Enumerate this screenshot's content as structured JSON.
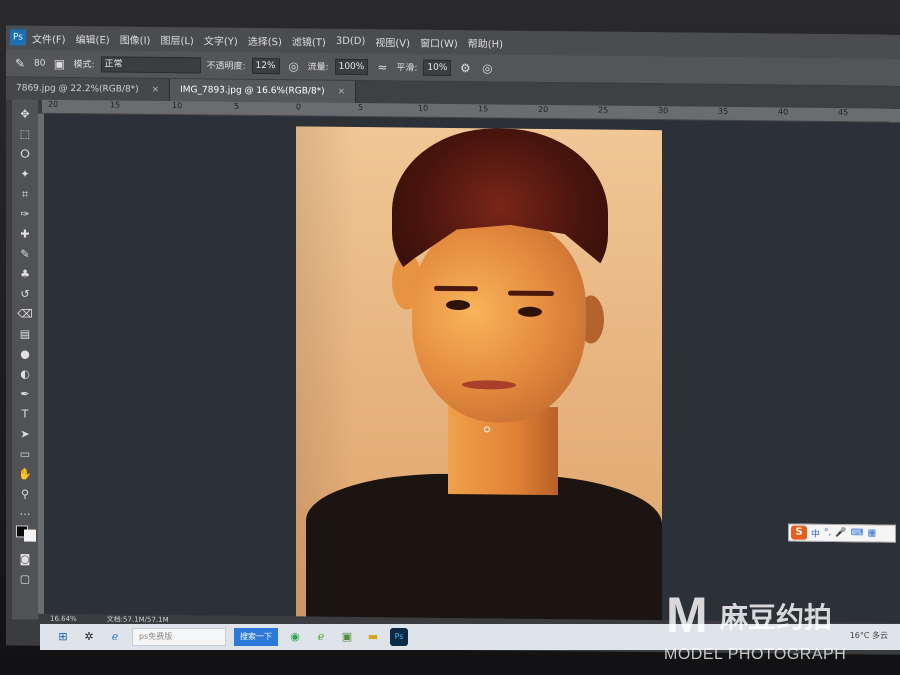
{
  "menubar": {
    "app_icon": "Ps",
    "items": [
      "文件(F)",
      "编辑(E)",
      "图像(I)",
      "图层(L)",
      "文字(Y)",
      "选择(S)",
      "滤镜(T)",
      "3D(D)",
      "视图(V)",
      "窗口(W)",
      "帮助(H)"
    ]
  },
  "options": {
    "brush_size": "80",
    "mode_label": "模式:",
    "mode_value": "正常",
    "opacity_label": "不透明度:",
    "opacity_value": "12%",
    "flow_label": "流量:",
    "flow_value": "100%",
    "smooth_label": "平滑:",
    "smooth_value": "10%"
  },
  "tabs": [
    {
      "label": "7869.jpg @ 22.2%(RGB/8*)",
      "close": "×"
    },
    {
      "label": "IMG_7893.jpg @ 16.6%(RGB/8*)",
      "close": "×"
    }
  ],
  "ruler": {
    "ticks": [
      "20",
      "15",
      "10",
      "5",
      "0",
      "5",
      "10",
      "15",
      "20",
      "25",
      "30",
      "35",
      "40",
      "45"
    ]
  },
  "status": {
    "zoom": "16.64%",
    "doc": "文档:57.1M/57.1M"
  },
  "ime": {
    "logo": "S",
    "mode": "中"
  },
  "taskbar": {
    "search_placeholder": "ps免费版",
    "search_button": "搜索一下",
    "ps_icon": "Ps",
    "weather": "16°C 多云"
  },
  "watermark": {
    "m": "M",
    "cn": "麻豆约拍",
    "en": "MODEL PHOTOGRAPH"
  },
  "colors": {
    "workspace": "#2c3037",
    "menubar": "#4a4c50",
    "accent": "#1c6fb3"
  }
}
